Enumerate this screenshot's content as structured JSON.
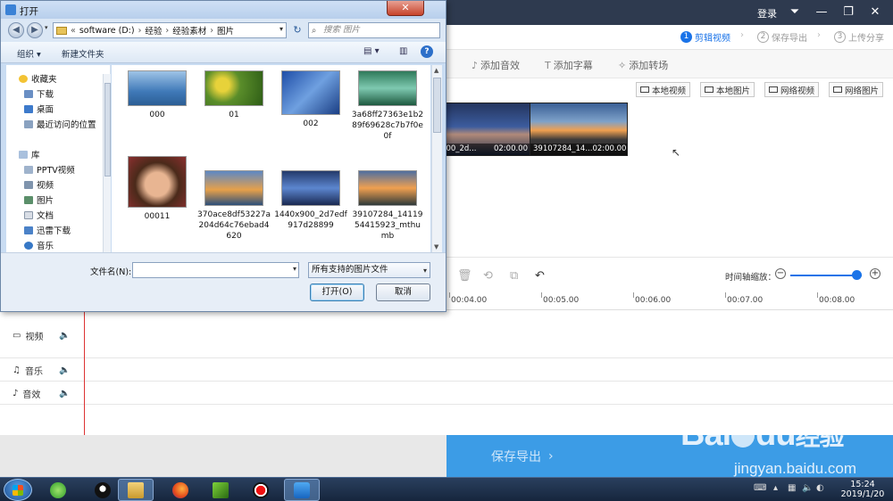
{
  "app": {
    "login": "登录",
    "steps": [
      {
        "num": "1",
        "label": "剪辑视频"
      },
      {
        "num": "2",
        "label": "保存导出"
      },
      {
        "num": "3",
        "label": "上传分享"
      }
    ],
    "tools": [
      "添加音效",
      "添加字幕",
      "添加转场"
    ],
    "media_buttons": [
      "本地视频",
      "本地图片",
      "网络视频",
      "网络图片"
    ],
    "thumbs": [
      {
        "name": "x900_2d...",
        "duration": "02:00.00"
      },
      {
        "name": "39107284_14...",
        "duration": "02:00.00"
      }
    ],
    "zoom_label": "时间轴缩放：",
    "zoom_level": 0.92,
    "ruler": [
      "00:04.00",
      "00:05.00",
      "00:06.00",
      "00:07.00",
      "00:08.00"
    ],
    "tracks": [
      "视频",
      "音乐",
      "音效"
    ],
    "save_export": "保存导出",
    "colors": {
      "accent": "#1a73e8",
      "titlebar": "#2e3a4f",
      "export_bg": "#3c9ce6",
      "playhead": "#dd3333"
    }
  },
  "dialog": {
    "title": "打开",
    "address": [
      "software (D:)",
      "经验",
      "经验素材",
      "图片"
    ],
    "address_prefix": "«",
    "search_placeholder": "搜索 图片",
    "cmd_organize": "组织 ▾",
    "cmd_new_folder": "新建文件夹",
    "nav": {
      "favorites_head": "收藏夹",
      "favorites": [
        "下载",
        "桌面",
        "最近访问的位置"
      ],
      "library_head": "库",
      "library": [
        "PPTV视频",
        "视频",
        "图片",
        "文档",
        "迅雷下载",
        "音乐"
      ]
    },
    "files": [
      {
        "name": "000"
      },
      {
        "name": "01"
      },
      {
        "name": "002"
      },
      {
        "name": "3a68ff27363e1b289f69628c7b7f0e0f"
      },
      {
        "name": "00011"
      },
      {
        "name": "370ace8df53227a204d64c76ebad4620"
      },
      {
        "name": "1440x900_2d7edf917d28899"
      },
      {
        "name": "39107284_1411954415923_mthumb"
      }
    ],
    "filename_label": "文件名(N):",
    "filename_value": "",
    "filetype": "所有支持的图片文件",
    "open_btn": "打开(O)",
    "cancel_btn": "取消"
  },
  "taskbar": {
    "time": "15:24",
    "date": "2019/1/20"
  },
  "watermark": {
    "brand_left": "Bai",
    "brand_right": "du",
    "brand_cn": "经验",
    "url": "jingyan.baidu.com"
  }
}
